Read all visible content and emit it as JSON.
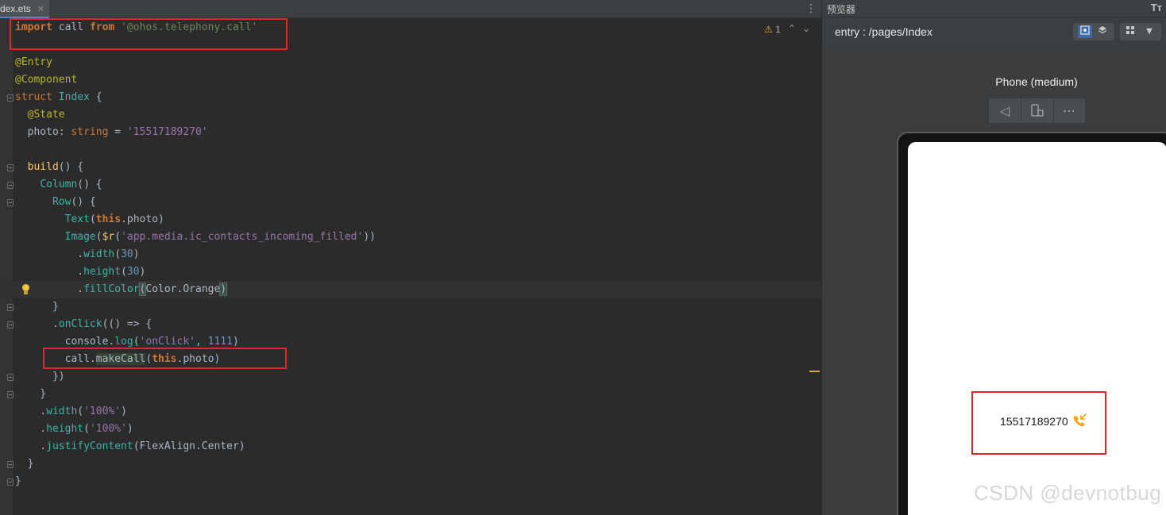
{
  "editor": {
    "tab_label": "dex.ets",
    "warning_count": "1",
    "code_lines": [
      [
        [
          "kwb",
          "import"
        ],
        [
          "",
          " call "
        ],
        [
          "kwb",
          "from"
        ],
        [
          "",
          " "
        ],
        [
          "str",
          "'@ohos.telephony.call'"
        ]
      ],
      [],
      [
        [
          "ann",
          "@Entry"
        ]
      ],
      [
        [
          "ann",
          "@Component"
        ]
      ],
      [
        [
          "kw",
          "struct"
        ],
        [
          "",
          " "
        ],
        [
          "teal",
          "Index"
        ],
        [
          "",
          " {"
        ]
      ],
      [
        [
          "",
          "  "
        ],
        [
          "ann",
          "@State"
        ]
      ],
      [
        [
          "",
          "  photo: "
        ],
        [
          "ty",
          "string"
        ],
        [
          "",
          " = "
        ],
        [
          "strp",
          "'15517189270'"
        ]
      ],
      [],
      [
        [
          "",
          "  "
        ],
        [
          "fn",
          "build"
        ],
        [
          "",
          "() {"
        ]
      ],
      [
        [
          "",
          "    "
        ],
        [
          "teal",
          "Column"
        ],
        [
          "",
          "() {"
        ]
      ],
      [
        [
          "",
          "      "
        ],
        [
          "teal",
          "Row"
        ],
        [
          "",
          "() {"
        ]
      ],
      [
        [
          "",
          "        "
        ],
        [
          "teal",
          "Text"
        ],
        [
          "",
          "("
        ],
        [
          "this",
          "this"
        ],
        [
          "",
          ".photo)"
        ]
      ],
      [
        [
          "",
          "        "
        ],
        [
          "teal",
          "Image"
        ],
        [
          "",
          "("
        ],
        [
          "fn",
          "$r"
        ],
        [
          "",
          "("
        ],
        [
          "strp",
          "'app.media.ic_contacts_incoming_filled'"
        ],
        [
          "",
          "))"
        ]
      ],
      [
        [
          "",
          "          ."
        ],
        [
          "teal",
          "width"
        ],
        [
          "",
          "("
        ],
        [
          "num",
          "30"
        ],
        [
          "",
          ")"
        ]
      ],
      [
        [
          "",
          "          ."
        ],
        [
          "teal",
          "height"
        ],
        [
          "",
          "("
        ],
        [
          "num",
          "30"
        ],
        [
          "",
          ")"
        ]
      ],
      [
        [
          "",
          "          ."
        ],
        [
          "teal",
          "fillColor"
        ],
        [
          "paren-hl",
          "("
        ],
        [
          "",
          "Color.Orange"
        ],
        [
          "paren-hl",
          ")"
        ]
      ],
      [
        [
          "",
          "      }"
        ]
      ],
      [
        [
          "",
          "      ."
        ],
        [
          "teal",
          "onClick"
        ],
        [
          "",
          "(() => {"
        ]
      ],
      [
        [
          "",
          "        console."
        ],
        [
          "teal",
          "log"
        ],
        [
          "",
          "("
        ],
        [
          "strp",
          "'onClick'"
        ],
        [
          "",
          ", "
        ],
        [
          "num",
          "1111"
        ],
        [
          "",
          ")"
        ]
      ],
      [
        [
          "",
          "        call."
        ],
        [
          "sel",
          "makeCall"
        ],
        [
          "",
          "("
        ],
        [
          "this",
          "this"
        ],
        [
          "",
          ".photo)"
        ]
      ],
      [
        [
          "",
          "      })"
        ]
      ],
      [
        [
          "",
          "    }"
        ]
      ],
      [
        [
          "",
          "    ."
        ],
        [
          "teal",
          "width"
        ],
        [
          "",
          "("
        ],
        [
          "strp",
          "'100%'"
        ],
        [
          "",
          ")"
        ]
      ],
      [
        [
          "",
          "    ."
        ],
        [
          "teal",
          "height"
        ],
        [
          "",
          "("
        ],
        [
          "strp",
          "'100%'"
        ],
        [
          "",
          ")"
        ]
      ],
      [
        [
          "",
          "    ."
        ],
        [
          "teal",
          "justifyContent"
        ],
        [
          "",
          "(FlexAlign.Center)"
        ]
      ],
      [
        [
          "",
          "  }"
        ]
      ],
      [
        [
          "",
          "}"
        ]
      ]
    ]
  },
  "preview": {
    "panel_title": "预览器",
    "path": "entry : /pages/Index",
    "device_name": "Phone (medium)",
    "app_text": "15517189270",
    "icon_color": "#f5a623"
  },
  "watermark": "CSDN @devnotbug"
}
